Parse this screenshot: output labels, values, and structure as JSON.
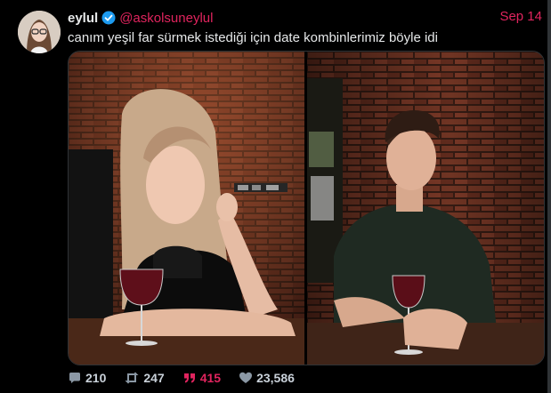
{
  "tweet": {
    "display_name": "eylul",
    "handle": "@askolsuneylul",
    "date": "Sep 14",
    "text": "canım yeşil far sürmek istediği için date kombinlerimiz böyle idi",
    "verified": true
  },
  "media": {
    "photos": [
      {
        "label": "woman-with-wine-glass"
      },
      {
        "label": "man-with-wine-glass"
      }
    ]
  },
  "stats": {
    "replies": "210",
    "retweets": "247",
    "quotes": "415",
    "likes": "23,586"
  },
  "colors": {
    "accent": "#e0245e",
    "verified": "#1d9bf0",
    "muted": "#8b98a5",
    "background": "#000000"
  }
}
